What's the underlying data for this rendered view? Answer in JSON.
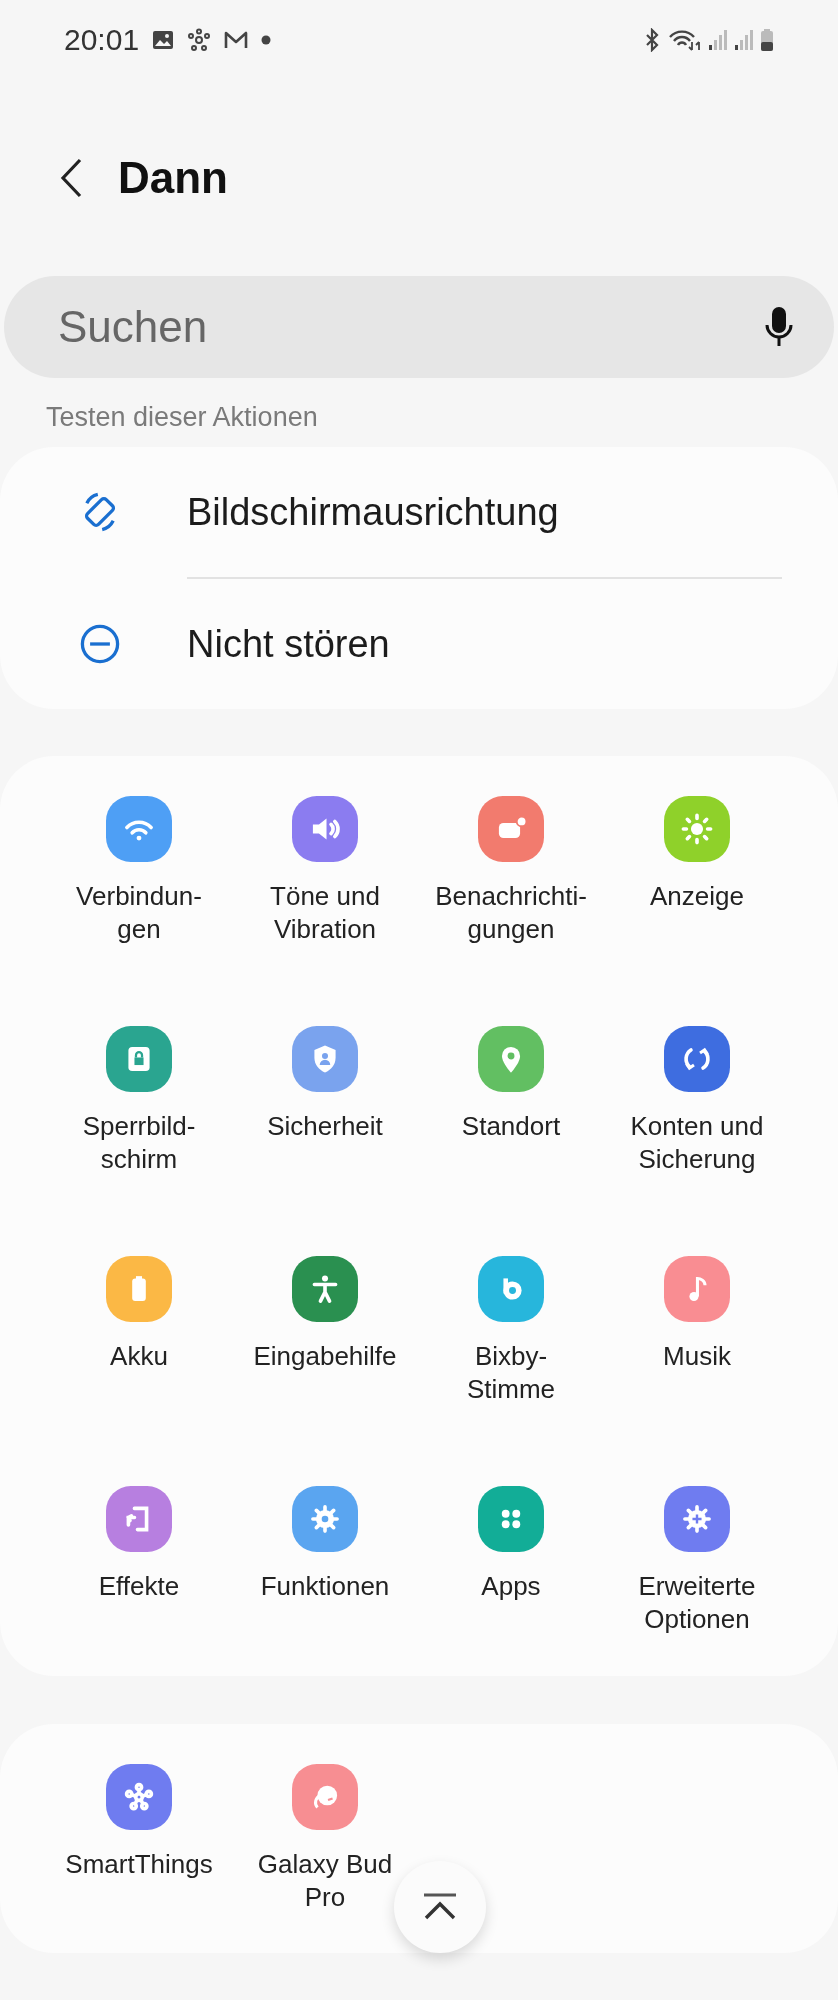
{
  "status_bar": {
    "time": "20:01"
  },
  "header": {
    "title": "Dann"
  },
  "search": {
    "placeholder": "Suchen"
  },
  "section_label": "Testen dieser Aktionen",
  "actions": [
    {
      "label": "Bildschirmausrichtung"
    },
    {
      "label": "Nicht stören"
    }
  ],
  "settings": [
    {
      "label": "Verbindun-\ngen",
      "color": "#4e9ff5"
    },
    {
      "label": "Töne und\nVibration",
      "color": "#8b7cf0"
    },
    {
      "label": "Benachrichti-\ngungen",
      "color": "#f27b6e"
    },
    {
      "label": "Anzeige",
      "color": "#8fd12a"
    },
    {
      "label": "Sperrbild-\nschirm",
      "color": "#2aa590"
    },
    {
      "label": "Sicherheit",
      "color": "#7aa3ee"
    },
    {
      "label": "Standort",
      "color": "#62bf62"
    },
    {
      "label": "Konten und\nSicherung",
      "color": "#3e6de0"
    },
    {
      "label": "Akku",
      "color": "#fbb845"
    },
    {
      "label": "Eingabehilfe",
      "color": "#2a9050"
    },
    {
      "label": "Bixby-\nStimme",
      "color": "#27b6dc"
    },
    {
      "label": "Musik",
      "color": "#f98d92"
    },
    {
      "label": "Effekte",
      "color": "#b77fe0"
    },
    {
      "label": "Funktionen",
      "color": "#5aa5f0"
    },
    {
      "label": "Apps",
      "color": "#12ad97"
    },
    {
      "label": "Erweiterte\nOptionen",
      "color": "#6f7cf0"
    }
  ],
  "apps": [
    {
      "label": "SmartThings",
      "color": "#6f7cf0"
    },
    {
      "label": "Galaxy Bud\nPro",
      "color": "#f78e92"
    }
  ]
}
